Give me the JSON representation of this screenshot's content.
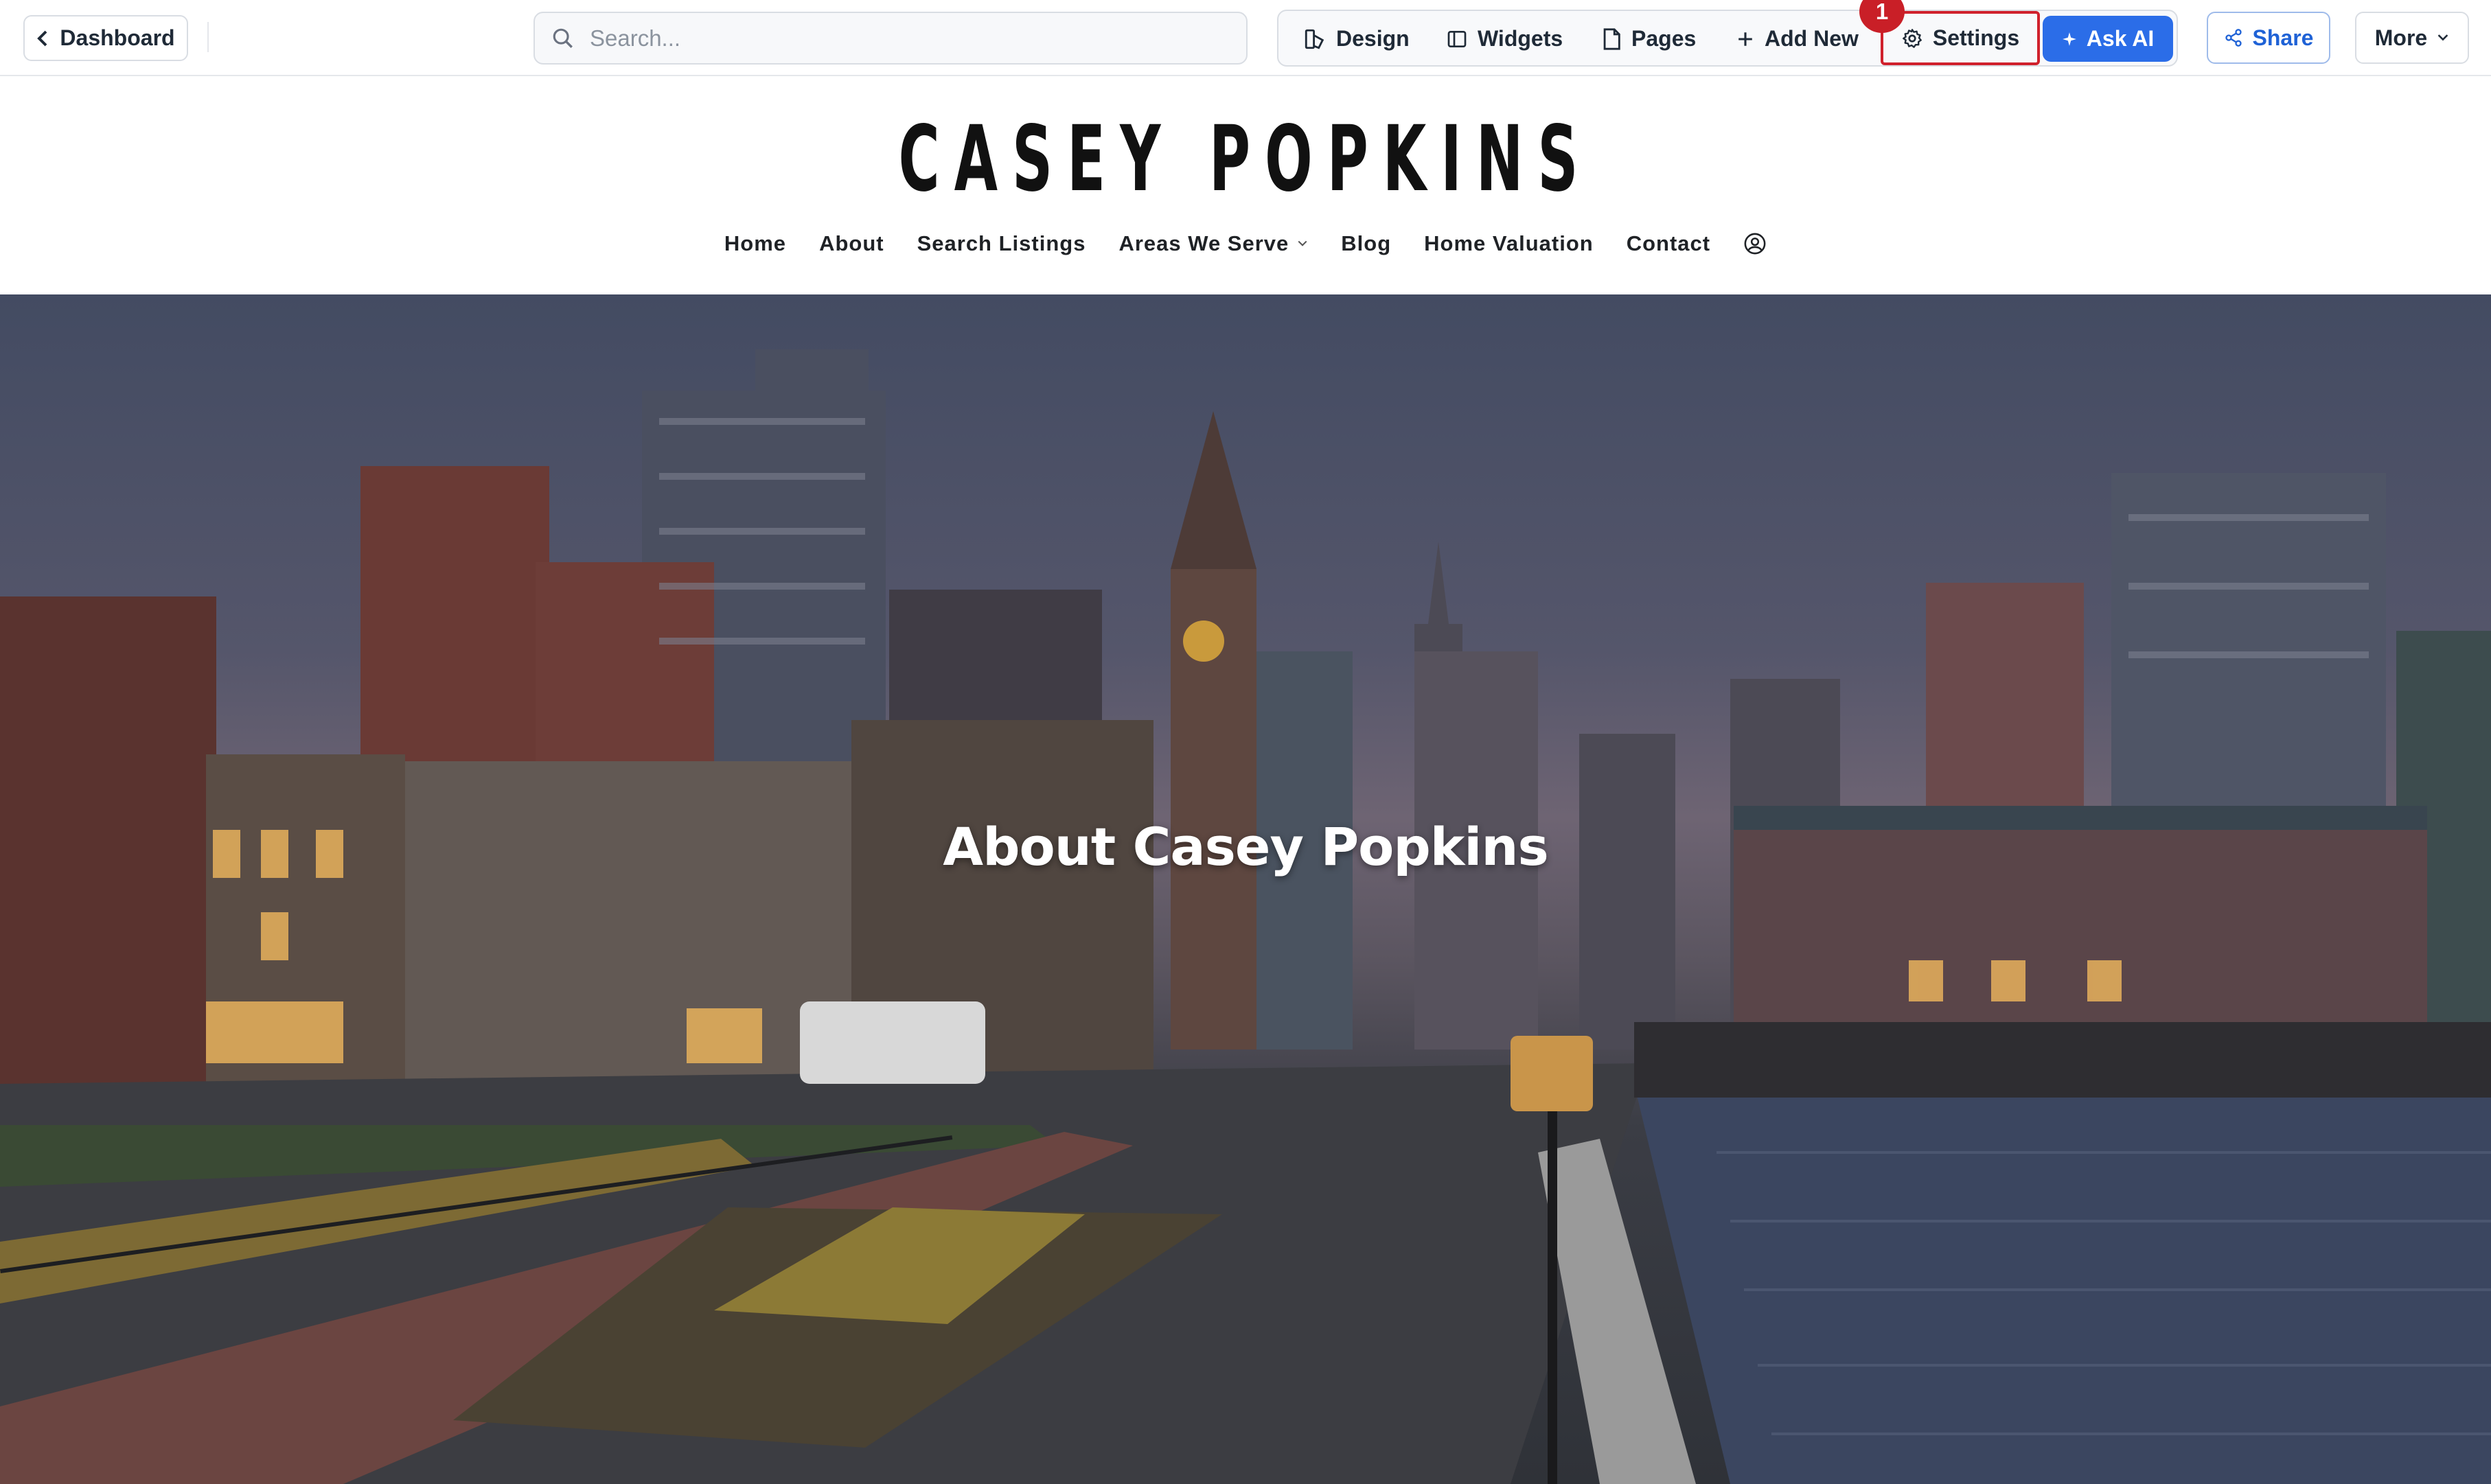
{
  "toolbar": {
    "dashboard_label": "Dashboard",
    "search_placeholder": "Search...",
    "design_label": "Design",
    "widgets_label": "Widgets",
    "pages_label": "Pages",
    "add_new_label": "Add New",
    "settings_label": "Settings",
    "ask_ai_label": "Ask AI",
    "share_label": "Share",
    "more_label": "More",
    "step_badge": "1"
  },
  "site": {
    "logo": "CASEY POPKINS",
    "nav": {
      "home": "Home",
      "about": "About",
      "search_listings": "Search Listings",
      "areas": "Areas We Serve",
      "blog": "Blog",
      "home_valuation": "Home Valuation",
      "contact": "Contact"
    },
    "hero_title": "About Casey Popkins"
  },
  "colors": {
    "accent_blue": "#2b6de8",
    "highlight_red": "#d0212c",
    "badge_red": "#c91f27"
  },
  "icons": [
    "chevron-left-icon",
    "search-icon",
    "design-icon",
    "widgets-icon",
    "page-icon",
    "plus-icon",
    "gear-icon",
    "sparkle-icon",
    "share-icon",
    "chevron-down-icon",
    "user-icon"
  ]
}
